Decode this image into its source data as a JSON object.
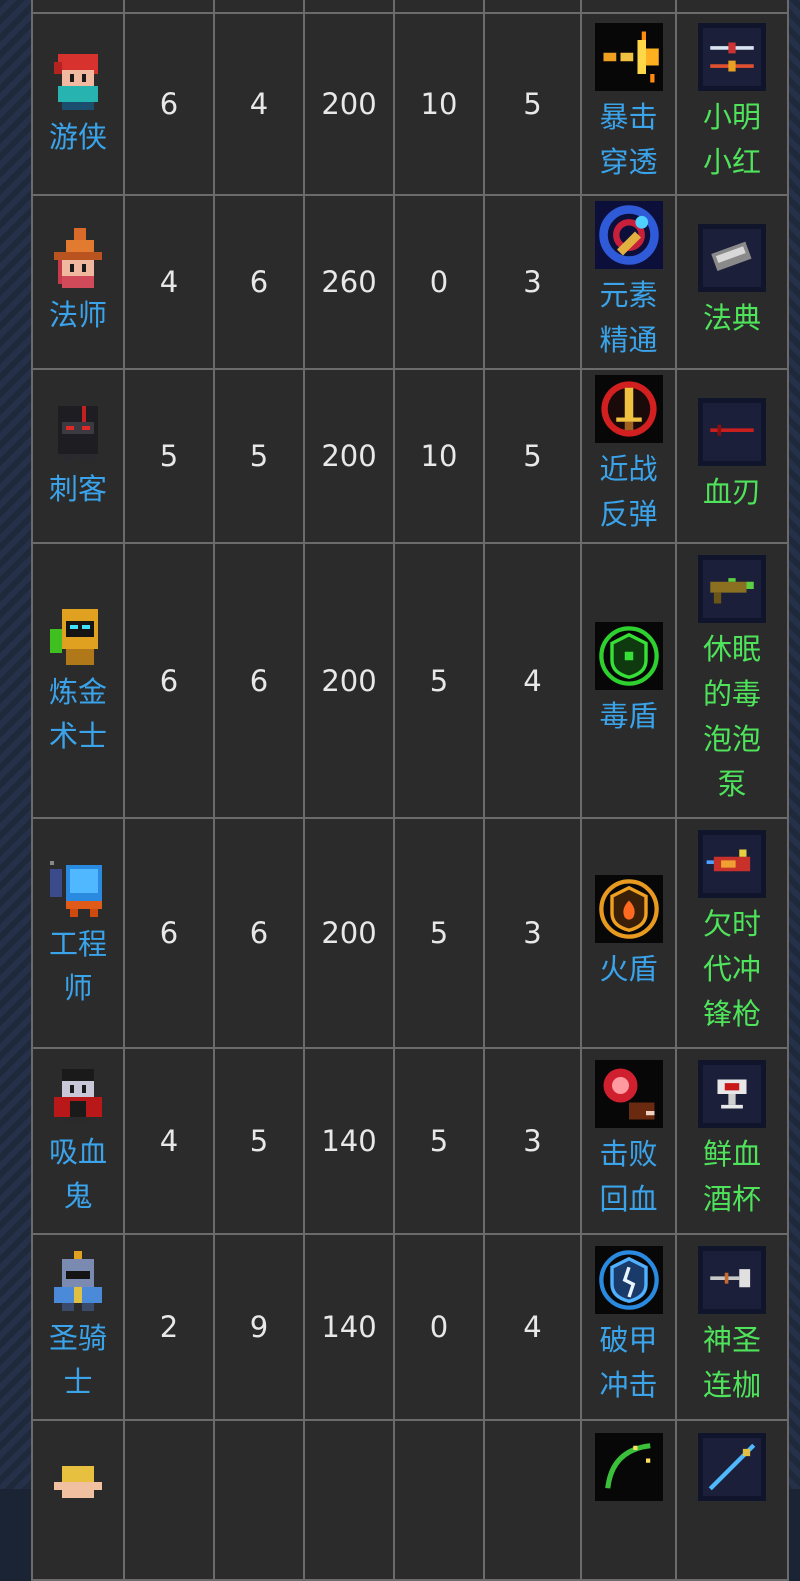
{
  "colors": {
    "table_bg": "#2b2b2b",
    "grid_line": "#6b6b6b",
    "number_text": "#e8e8e8",
    "name_text": "#3aa3ea",
    "weapon_text": "#4ee35a",
    "frame_bg": "#1b2435"
  },
  "rows": [
    {
      "hero": "游侠",
      "hero_icon": "ranger-icon",
      "stats": [
        "6",
        "4",
        "200",
        "10",
        "5"
      ],
      "skill": "暴击穿透",
      "skill_icon": "crit-spark-icon",
      "weapon": "小明小红",
      "weapon_icon": "twin-crossbow-icon"
    },
    {
      "hero": "法师",
      "hero_icon": "wizard-icon",
      "stats": [
        "4",
        "6",
        "260",
        "0",
        "3"
      ],
      "skill": "元素精通",
      "skill_icon": "element-vortex-icon",
      "weapon": "法典",
      "weapon_icon": "spellbook-icon"
    },
    {
      "hero": "刺客",
      "hero_icon": "assassin-icon",
      "stats": [
        "5",
        "5",
        "200",
        "10",
        "5"
      ],
      "skill": "近战反弹",
      "skill_icon": "sword-reflect-icon",
      "weapon": "血刃",
      "weapon_icon": "blood-blade-icon"
    },
    {
      "hero": "炼金术士",
      "hero_icon": "alchemist-icon",
      "stats": [
        "6",
        "6",
        "200",
        "5",
        "4"
      ],
      "skill": "毒盾",
      "skill_icon": "poison-shield-icon",
      "weapon": "休眠的毒泡泡泵",
      "weapon_icon": "bubble-pump-icon"
    },
    {
      "hero": "工程师",
      "hero_icon": "engineer-icon",
      "stats": [
        "6",
        "6",
        "200",
        "5",
        "3"
      ],
      "skill": "火盾",
      "skill_icon": "fire-shield-icon",
      "weapon": "欠时代冲锋枪",
      "weapon_icon": "smg-icon"
    },
    {
      "hero": "吸血鬼",
      "hero_icon": "vampire-icon",
      "stats": [
        "4",
        "5",
        "140",
        "5",
        "3"
      ],
      "skill": "击败回血",
      "skill_icon": "blood-orb-icon",
      "weapon": "鲜血酒杯",
      "weapon_icon": "blood-chalice-icon"
    },
    {
      "hero": "圣骑士",
      "hero_icon": "paladin-icon",
      "stats": [
        "2",
        "9",
        "140",
        "0",
        "4"
      ],
      "skill": "破甲冲击",
      "skill_icon": "armor-break-icon",
      "weapon": "神圣连枷",
      "weapon_icon": "holy-flail-icon"
    },
    {
      "hero": "",
      "hero_icon": "elf-icon",
      "stats": [
        "",
        "",
        "",
        "",
        ""
      ],
      "skill": "",
      "skill_icon": "bow-icon",
      "weapon": "",
      "weapon_icon": "staff-icon"
    }
  ]
}
